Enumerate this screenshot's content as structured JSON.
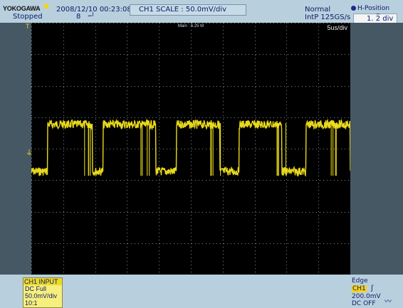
{
  "header": {
    "brand": "YOKOGAWA",
    "status": "Stopped",
    "datetime": "2008/12/10 00:23:08",
    "acq_count": "8",
    "trigger_symbol": "ᆈ",
    "scale_label": "CH1  SCALE  :  50.0mV/div",
    "mode": "Normal",
    "sample_rate": "IntP  125GS/s",
    "hposition_label": "H-Position",
    "hposition_value": "1. 2̅ div"
  },
  "screen": {
    "main_label": "Main : 6.25 M",
    "time_div": "5us/div",
    "trigger_marker": "T",
    "ground_marker": "⏚"
  },
  "channel": {
    "header": "CH1 INPUT",
    "coupling": "DC Full",
    "scale": "50.0mV/div",
    "probe": "10:1"
  },
  "trigger": {
    "type": "Edge",
    "source": "CH1",
    "slope_icon": "rising-edge-icon",
    "level": "200.0mV",
    "coupling": "DC OFF",
    "noise_icon": "noise-rejection-icon"
  },
  "colors": {
    "trace": "#f6e51e",
    "screen_bg": "#000000",
    "panel_bg": "#b8d0de",
    "side_panel": "#465863",
    "grid": "#7f8a90"
  },
  "waveform": {
    "levels": {
      "high": 1,
      "low": 0
    },
    "segments": [
      [
        "start",
        0
      ],
      [
        0.05,
        1
      ],
      [
        0.19,
        0
      ],
      [
        0.225,
        1
      ],
      [
        0.39,
        0
      ],
      [
        0.455,
        1
      ],
      [
        0.59,
        0
      ],
      [
        0.65,
        1
      ],
      [
        0.785,
        0
      ],
      [
        0.86,
        1
      ],
      [
        1.0,
        0
      ]
    ],
    "glitch_windows": [
      [
        0.135,
        0.19
      ],
      [
        0.34,
        0.39
      ],
      [
        0.56,
        0.6
      ],
      [
        0.765,
        0.8
      ],
      [
        0.94,
        0.96
      ]
    ]
  }
}
